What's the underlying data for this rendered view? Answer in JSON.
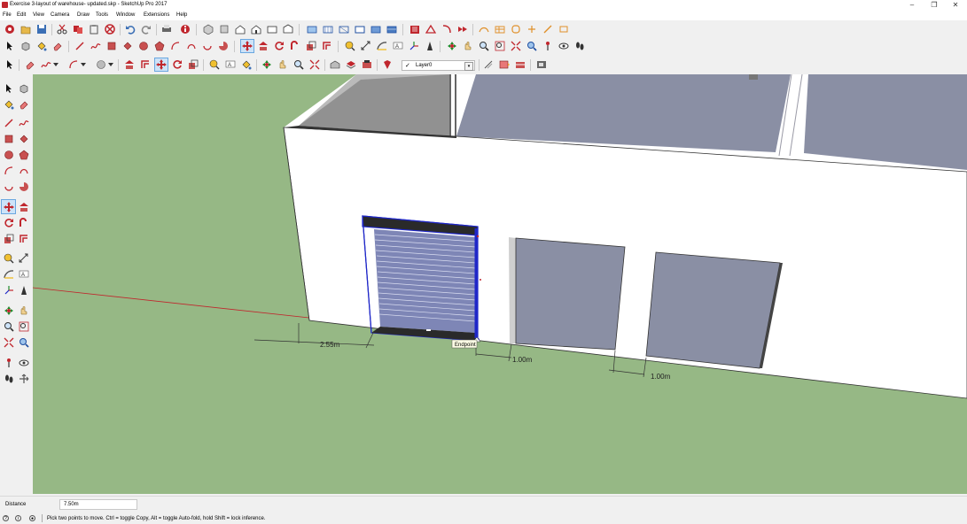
{
  "window": {
    "title": "Exercise 3-layout of warehouse- updated.skp - SketchUp Pro 2017",
    "controls": {
      "minimize": "–",
      "maximize": "❐",
      "close": "✕"
    }
  },
  "menu": [
    "File",
    "Edit",
    "View",
    "Camera",
    "Draw",
    "Tools",
    "Window",
    "Extensions",
    "Help"
  ],
  "layer": {
    "check": "✓",
    "name": "Layer0",
    "arrow": "▾"
  },
  "viewport": {
    "dimensions": [
      "2.55m",
      "1.00m",
      "1.00m"
    ],
    "tooltip": "Endpoint",
    "colors": {
      "ground": "#96b885",
      "wall": "#ffffff",
      "roof": "#8a8fa4",
      "door": "#8a8fa4",
      "selection": "#1f27c8",
      "axis_red": "#c0262d"
    }
  },
  "vcb": {
    "label": "Distance",
    "value": "7.50m"
  },
  "status": {
    "icons": [
      "?",
      "i",
      "●"
    ],
    "text": "Pick two points to move.  Ctrl = toggle Copy, Alt = toggle Auto-fold, hold Shift = lock inference."
  }
}
